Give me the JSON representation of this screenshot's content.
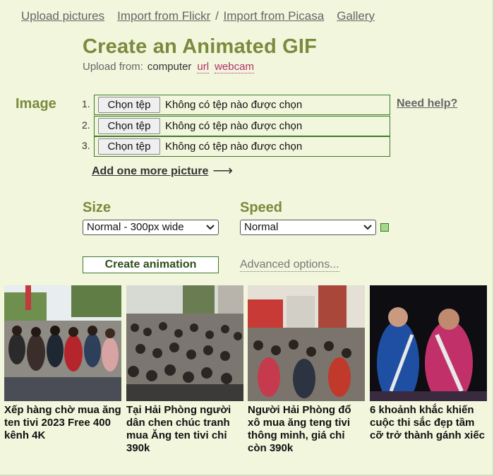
{
  "nav": {
    "upload": "Upload pictures",
    "flickr": "Import from Flickr",
    "picasa": "Import from Picasa",
    "gallery": "Gallery"
  },
  "title": "Create an Animated GIF",
  "upload_from": {
    "label": "Upload from:",
    "computer": "computer",
    "url": "url",
    "webcam": "webcam"
  },
  "image_section": {
    "label": "Image",
    "rows": [
      {
        "num": "1.",
        "button": "Chọn tệp",
        "status": "Không có tệp nào được chọn"
      },
      {
        "num": "2.",
        "button": "Chọn tệp",
        "status": "Không có tệp nào được chọn"
      },
      {
        "num": "3.",
        "button": "Chọn tệp",
        "status": "Không có tệp nào được chọn"
      }
    ],
    "need_help": "Need help?",
    "add_more": "Add one more picture",
    "add_more_arrow": "⟶"
  },
  "size": {
    "label": "Size",
    "selected": "Normal - 300px wide"
  },
  "speed": {
    "label": "Speed",
    "selected": "Normal"
  },
  "create_button": "Create animation",
  "advanced": "Advanced options...",
  "gallery": [
    {
      "caption": "Xếp hàng chờ mua ăng ten tivi 2023 Free 400 kênh 4K"
    },
    {
      "caption": "Tại Hải Phòng người dân chen chúc tranh mua Ăng ten tivi chỉ 390k"
    },
    {
      "caption": "Người Hải Phòng đổ xô mua ăng teng tivi thông minh, giá chỉ còn 390k"
    },
    {
      "caption": "6 khoảnh khắc khiến cuộc thi sắc đẹp tầm cỡ trở thành gánh xiếc"
    }
  ],
  "colors": {
    "background": "#f2f6dc",
    "accent_olive": "#7a8a3e",
    "link_magenta": "#b0306a",
    "border_green": "#3a7a2a"
  }
}
